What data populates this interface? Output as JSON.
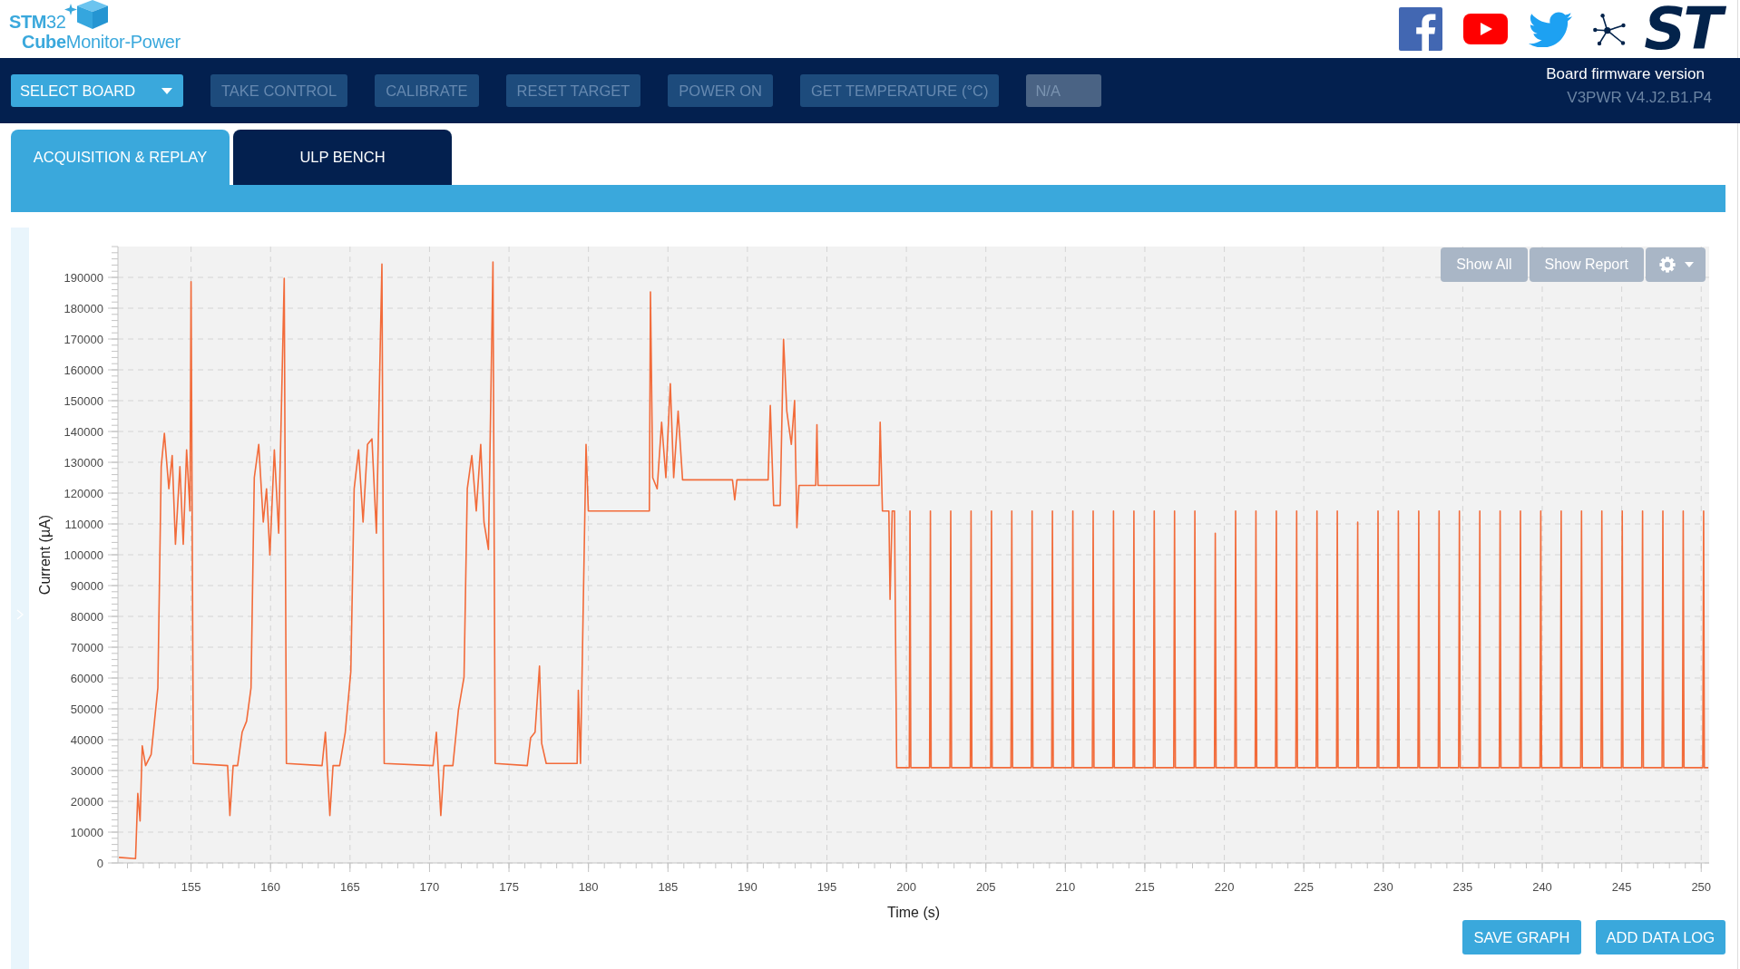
{
  "header": {
    "logo_top": "**STM**32",
    "logo_bottom": "**Cube**Monitor-Power",
    "brand_mark": "ST"
  },
  "toolbar": {
    "buttons": [
      {
        "label": "SELECT BOARD",
        "kind": "dropdown",
        "disabled": false
      },
      {
        "label": "TAKE CONTROL",
        "kind": "button",
        "disabled": true
      },
      {
        "label": "CALIBRATE",
        "kind": "button",
        "disabled": true
      },
      {
        "label": "RESET TARGET",
        "kind": "button",
        "disabled": true
      },
      {
        "label": "POWER ON",
        "kind": "button",
        "disabled": true
      },
      {
        "label": "GET TEMPERATURE (°C)",
        "kind": "button",
        "disabled": true
      }
    ],
    "temperature_field": {
      "value": "N/A",
      "disabled": true
    },
    "firmware": {
      "label": "Board firmware version",
      "value": "V3PWR V4.J2.B1.P4"
    }
  },
  "tabs": [
    {
      "label": "ACQUISITION & REPLAY",
      "selected": true
    },
    {
      "label": "ULP BENCH",
      "selected": false
    }
  ],
  "chart": {
    "buttons": [
      "Show All",
      "Show Report"
    ],
    "chart_data": {
      "type": "line",
      "grid": true,
      "xlabel": "Time (s)",
      "ylabel": "Current (µA)",
      "xlim": [
        150.4,
        250.5
      ],
      "ylim": [
        0,
        200000
      ],
      "xticks": [
        155,
        160,
        165,
        170,
        175,
        180,
        185,
        190,
        195,
        200,
        205,
        210,
        215,
        220,
        225,
        230,
        235,
        240,
        245,
        250
      ],
      "yticks": [
        0,
        10000,
        20000,
        30000,
        40000,
        50000,
        60000,
        70000,
        80000,
        90000,
        100000,
        110000,
        120000,
        130000,
        140000,
        150000,
        160000,
        170000,
        180000,
        190000
      ],
      "x": [
        150.46,
        151.51,
        151.65,
        151.79,
        151.93,
        152.14,
        152.49,
        152.7,
        152.91,
        153.12,
        153.32,
        153.6,
        153.81,
        154.02,
        154.3,
        154.51,
        154.72,
        154.93,
        155.0,
        155.14,
        157.3,
        157.44,
        157.65,
        157.93,
        158.21,
        158.49,
        158.77,
        158.98,
        159.26,
        159.54,
        159.75,
        159.96,
        160.24,
        160.51,
        160.86,
        161.0,
        163.24,
        163.45,
        163.73,
        163.93,
        164.35,
        164.7,
        165.05,
        165.26,
        165.54,
        165.82,
        166.1,
        166.38,
        166.66,
        167.01,
        167.15,
        170.22,
        170.43,
        170.71,
        170.91,
        171.47,
        171.82,
        172.17,
        172.38,
        172.66,
        172.94,
        173.22,
        173.43,
        173.71,
        173.99,
        174.13,
        176.15,
        176.36,
        176.64,
        176.92,
        177.06,
        177.34,
        179.29,
        179.36,
        179.5,
        179.85,
        179.99,
        183.83,
        183.9,
        184.04,
        184.32,
        184.6,
        184.87,
        185.15,
        185.36,
        185.64,
        185.92,
        189.06,
        189.2,
        189.34,
        191.3,
        191.44,
        191.65,
        192.06,
        192.27,
        192.48,
        192.76,
        192.97,
        193.11,
        193.25,
        194.3,
        194.37,
        194.44,
        198.28,
        198.35,
        198.49,
        198.9,
        198.97,
        199.11,
        199.25,
        199.39,
        200.18,
        200.23,
        200.28,
        201.46,
        201.51,
        201.56,
        202.74,
        202.79,
        202.84,
        204.02,
        204.07,
        204.12,
        205.3,
        205.35,
        205.4,
        206.58,
        206.63,
        206.68,
        207.86,
        207.91,
        207.96,
        209.14,
        209.19,
        209.24,
        210.42,
        210.47,
        210.52,
        211.7,
        211.75,
        211.8,
        212.98,
        213.03,
        213.08,
        214.26,
        214.31,
        214.36,
        215.54,
        215.59,
        215.64,
        216.82,
        216.87,
        216.92,
        218.1,
        218.15,
        218.2,
        219.38,
        219.43,
        219.48,
        220.66,
        220.71,
        220.76,
        221.94,
        221.99,
        222.04,
        223.22,
        223.27,
        223.32,
        224.5,
        224.55,
        224.6,
        225.78,
        225.83,
        225.88,
        227.06,
        227.11,
        227.16,
        228.34,
        228.39,
        228.44,
        229.62,
        229.67,
        229.72,
        230.9,
        230.95,
        231.0,
        232.18,
        232.23,
        232.28,
        233.46,
        233.51,
        233.56,
        234.74,
        234.79,
        234.84,
        236.02,
        236.07,
        236.12,
        237.3,
        237.35,
        237.4,
        238.58,
        238.63,
        238.68,
        239.86,
        239.91,
        239.96,
        241.14,
        241.19,
        241.24,
        242.42,
        242.47,
        242.52,
        243.7,
        243.75,
        243.8,
        244.98,
        245.03,
        245.08,
        246.26,
        246.31,
        246.36,
        247.54,
        247.59,
        247.64,
        248.82,
        248.87,
        248.92,
        250.1,
        250.15,
        250.2,
        250.45
      ],
      "series": [
        {
          "color": "#f26b3a",
          "values": [
            1800,
            1400,
            22600,
            13600,
            38000,
            31600,
            35200,
            46000,
            56800,
            128600,
            139400,
            121400,
            132200,
            103400,
            128600,
            103400,
            134000,
            114200,
            188600,
            32300,
            31600,
            15400,
            31600,
            31600,
            42400,
            46000,
            56800,
            125000,
            135800,
            110600,
            121400,
            99900,
            134000,
            107000,
            189700,
            32300,
            31600,
            42400,
            15400,
            31600,
            31600,
            42400,
            62100,
            121400,
            134000,
            110600,
            135800,
            137600,
            107000,
            194300,
            32300,
            31600,
            42400,
            15400,
            31600,
            31600,
            49600,
            60300,
            121400,
            132200,
            114200,
            135800,
            110600,
            101700,
            195000,
            32300,
            31600,
            40600,
            42400,
            63900,
            38800,
            32300,
            32300,
            56000,
            32300,
            135800,
            114200,
            114200,
            185300,
            125000,
            121400,
            143000,
            125000,
            155500,
            125000,
            146600,
            124300,
            124300,
            117800,
            124300,
            124300,
            148400,
            116000,
            116000,
            169900,
            146600,
            135800,
            150100,
            108800,
            122500,
            122500,
            142200,
            122500,
            122500,
            143000,
            114200,
            114200,
            85500,
            114200,
            114200,
            30900,
            30900,
            114200,
            30900,
            30900,
            114200,
            30900,
            30900,
            114200,
            30900,
            30900,
            114200,
            30900,
            30900,
            114200,
            30900,
            30900,
            114200,
            30900,
            30900,
            114200,
            30900,
            30900,
            114200,
            30900,
            30900,
            114200,
            30900,
            30900,
            114200,
            30900,
            30900,
            114200,
            30900,
            30900,
            114200,
            30900,
            30900,
            114200,
            30900,
            30900,
            114200,
            30900,
            30900,
            114200,
            30900,
            30900,
            107000,
            30900,
            30900,
            114200,
            30900,
            30900,
            114200,
            30900,
            30900,
            114200,
            30900,
            30900,
            114200,
            30900,
            30900,
            114200,
            30900,
            30900,
            114200,
            30900,
            30900,
            110600,
            30900,
            30900,
            114200,
            30900,
            30900,
            114200,
            30900,
            30900,
            114200,
            30900,
            30900,
            114200,
            30900,
            30900,
            114200,
            30900,
            30900,
            114200,
            30900,
            30900,
            114200,
            30900,
            30900,
            114200,
            30900,
            30900,
            114200,
            30900,
            30900,
            114200,
            30900,
            30900,
            114200,
            30900,
            30900,
            114200,
            30900,
            30900,
            114200,
            30900,
            30900,
            114200,
            30900,
            30900,
            114200,
            30900,
            30900,
            114200,
            30900,
            30900,
            114200,
            30900,
            30900
          ]
        }
      ]
    }
  },
  "actions": [
    "SAVE GRAPH",
    "ADD DATA LOG"
  ]
}
